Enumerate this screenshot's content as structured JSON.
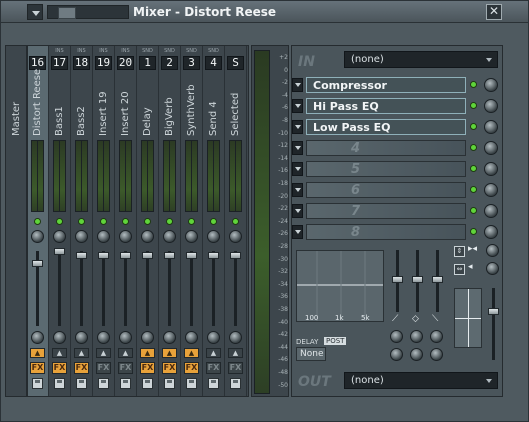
{
  "window": {
    "title": "Mixer - Distort Reese",
    "close_glyph": "✕"
  },
  "master": {
    "label": "Master"
  },
  "strips": [
    {
      "route": "",
      "num": "16",
      "name": "Distort Reese",
      "selected": true,
      "send_on": true,
      "fx_on": true
    },
    {
      "route": "INS",
      "num": "17",
      "name": "Bass1",
      "selected": false,
      "send_on": false,
      "fx_on": true
    },
    {
      "route": "INS",
      "num": "18",
      "name": "Bass2",
      "selected": false,
      "send_on": false,
      "fx_on": true
    },
    {
      "route": "INS",
      "num": "19",
      "name": "Insert 19",
      "selected": false,
      "send_on": false,
      "fx_on": false
    },
    {
      "route": "INS",
      "num": "20",
      "name": "Insert 20",
      "selected": false,
      "send_on": false,
      "fx_on": false
    },
    {
      "route": "SND",
      "num": "1",
      "name": "Delay",
      "selected": false,
      "send_on": true,
      "fx_on": true
    },
    {
      "route": "SND",
      "num": "2",
      "name": "BigVerb",
      "selected": false,
      "send_on": true,
      "fx_on": true
    },
    {
      "route": "SND",
      "num": "3",
      "name": "SynthVerb",
      "selected": false,
      "send_on": true,
      "fx_on": true
    },
    {
      "route": "SND",
      "num": "4",
      "name": "Send 4",
      "selected": false,
      "send_on": false,
      "fx_on": false
    },
    {
      "route": "",
      "num": "S",
      "name": "Selected",
      "selected": false,
      "send_on": false,
      "fx_on": false
    }
  ],
  "strip_controls": {
    "fx_label": "FX"
  },
  "scale_ticks": [
    "+2",
    "0",
    "-2",
    "-4",
    "-6",
    "-8",
    "-10",
    "-12",
    "-14",
    "-16",
    "-18",
    "-20",
    "-22",
    "-24",
    "-26",
    "-28",
    "-30",
    "-32",
    "-34",
    "-36",
    "-38",
    "-40",
    "-42",
    "-44",
    "-46",
    "-48",
    "-50"
  ],
  "fx_panel": {
    "in_label": "IN",
    "in_value": "(none)",
    "slots": [
      {
        "name": "Compressor"
      },
      {
        "name": "Hi Pass EQ"
      },
      {
        "name": "Low Pass EQ"
      },
      {
        "name": "",
        "number": "4"
      },
      {
        "name": "",
        "number": "5"
      },
      {
        "name": "",
        "number": "6"
      },
      {
        "name": "",
        "number": "7"
      },
      {
        "name": "",
        "number": "8"
      }
    ],
    "eq": {
      "freq_labels": [
        "100",
        "1k",
        "5k"
      ]
    },
    "delay_label": "DELAY",
    "post_label": "POST",
    "delay_value": "None",
    "out_label": "OUT",
    "out_value": "(none)"
  }
}
